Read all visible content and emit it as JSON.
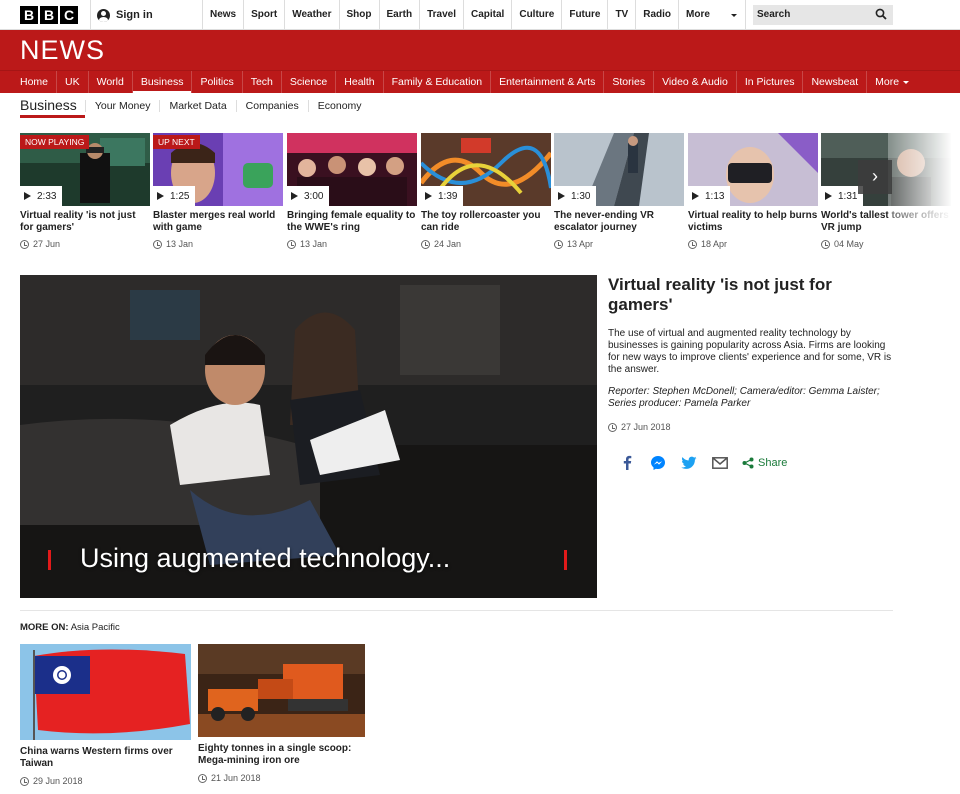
{
  "topbar": {
    "logo_letters": [
      "B",
      "B",
      "C"
    ],
    "signin_label": "Sign in",
    "nav": [
      "News",
      "Sport",
      "Weather",
      "Shop",
      "Earth",
      "Travel",
      "Capital",
      "Culture",
      "Future",
      "TV",
      "Radio",
      "More"
    ],
    "search_label": "Search"
  },
  "news_logo": "NEWS",
  "rednav": {
    "items": [
      "Home",
      "UK",
      "World",
      "Business",
      "Politics",
      "Tech",
      "Science",
      "Health",
      "Family & Education",
      "Entertainment & Arts",
      "Stories",
      "Video & Audio",
      "In Pictures",
      "Newsbeat",
      "More"
    ],
    "active": "Business"
  },
  "subnav": {
    "section": "Business",
    "items": [
      "Your Money",
      "Market Data",
      "Companies",
      "Economy"
    ]
  },
  "strip": [
    {
      "badge": "NOW PLAYING",
      "duration": "2:33",
      "title": "Virtual reality 'is not just for gamers'",
      "date": "27 Jun"
    },
    {
      "badge": "UP NEXT",
      "duration": "1:25",
      "title": "Blaster merges real world with game",
      "date": "13 Jan"
    },
    {
      "badge": "",
      "duration": "3:00",
      "title": "Bringing female equality to the WWE's ring",
      "date": "13 Jan"
    },
    {
      "badge": "",
      "duration": "1:39",
      "title": "The toy rollercoaster you can ride",
      "date": "24 Jan"
    },
    {
      "badge": "",
      "duration": "1:30",
      "title": "The never-ending VR escalator journey",
      "date": "13 Apr"
    },
    {
      "badge": "",
      "duration": "1:13",
      "title": "Virtual reality to help burns victims",
      "date": "18 Apr"
    },
    {
      "badge": "",
      "duration": "1:31",
      "title": "World's tallest tower offers VR jump",
      "date": "04 May"
    }
  ],
  "hero": {
    "caption": "Using augmented technology..."
  },
  "article": {
    "headline": "Virtual reality 'is not just for gamers'",
    "summary": "The use of virtual and augmented reality technology by businesses is gaining popularity across Asia. Firms are looking for new ways to improve clients' experience and for some, VR is the answer.",
    "credits": "Reporter: Stephen McDonell; Camera/editor: Gemma Laister; Series producer: Pamela Parker",
    "date": "27 Jun 2018",
    "share_label": "Share",
    "share_icons": [
      "facebook-icon",
      "messenger-icon",
      "twitter-icon",
      "email-icon",
      "share-icon"
    ]
  },
  "more_on": {
    "prefix": "MORE ON:",
    "topic": "Asia Pacific",
    "items": [
      {
        "title": "China warns Western firms over Taiwan",
        "date": "29 Jun 2018"
      },
      {
        "title": "Eighty tonnes in a single scoop: Mega-mining iron ore",
        "date": "21 Jun 2018"
      }
    ]
  },
  "colors": {
    "brand_red": "#bb1919",
    "share_green": "#1a7a3a"
  }
}
